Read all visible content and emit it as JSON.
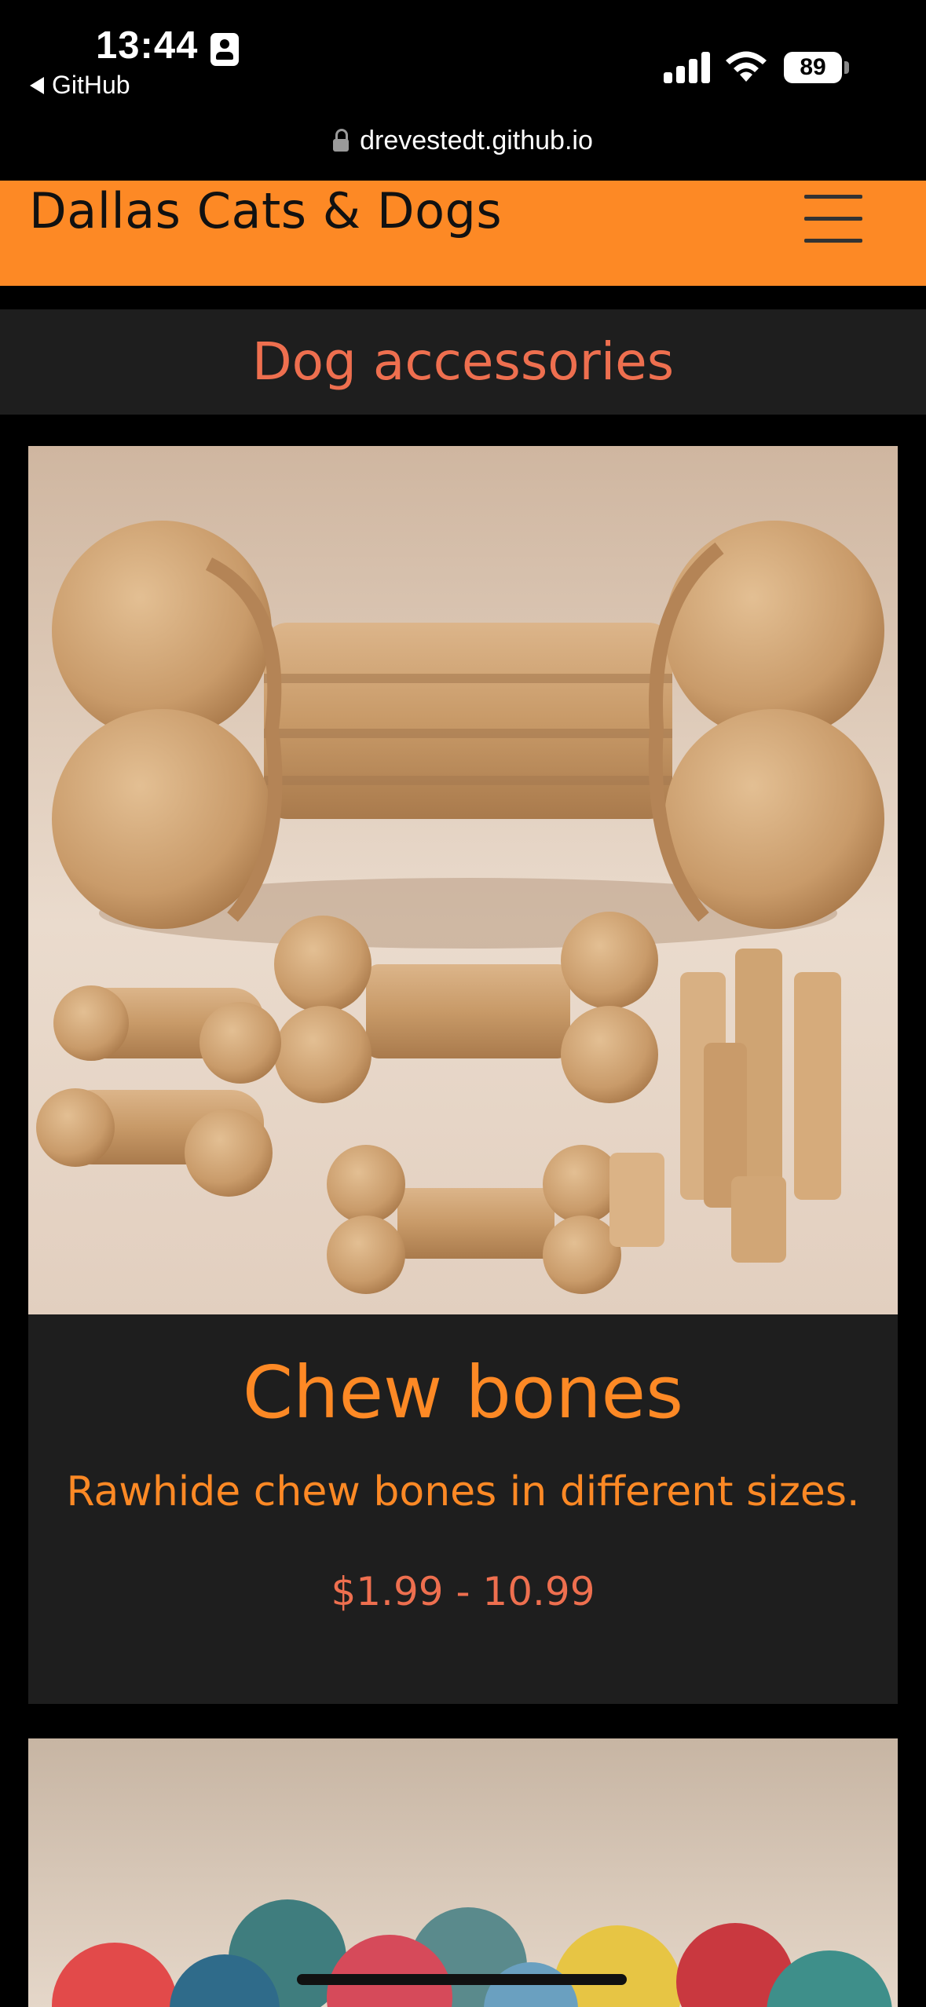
{
  "status_bar": {
    "time": "13:44",
    "back_label": "GitHub",
    "battery": "89"
  },
  "browser": {
    "url": "drevestedt.github.io"
  },
  "header": {
    "site_title": "Dallas Cats & Dogs"
  },
  "section": {
    "title": "Dog accessories"
  },
  "products": [
    {
      "name": "Chew bones",
      "description": "Rawhide chew bones in different sizes.",
      "price": "$1.99 - 10.99"
    }
  ],
  "colors": {
    "accent_orange": "#fd8925",
    "heading_coral": "#ee6f4f",
    "card_bg": "#1e1e1e",
    "page_bg": "#000000"
  },
  "icons": [
    "id-card-icon",
    "back-caret-icon",
    "signal-icon",
    "wifi-icon",
    "battery-icon",
    "lock-icon",
    "hamburger-menu-icon"
  ]
}
